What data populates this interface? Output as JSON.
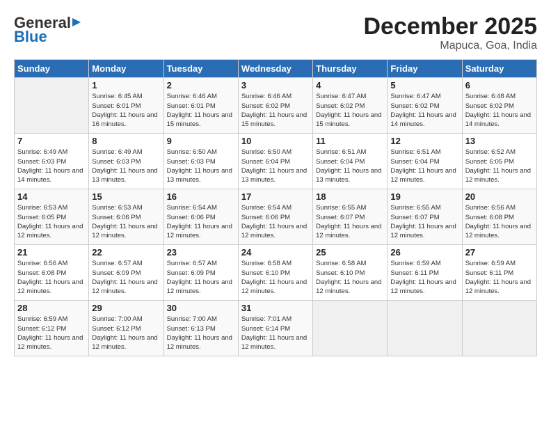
{
  "header": {
    "logo_general": "General",
    "logo_blue": "Blue",
    "month": "December 2025",
    "location": "Mapuca, Goa, India"
  },
  "days_of_week": [
    "Sunday",
    "Monday",
    "Tuesday",
    "Wednesday",
    "Thursday",
    "Friday",
    "Saturday"
  ],
  "weeks": [
    [
      {
        "day": "",
        "sunrise": "",
        "sunset": "",
        "daylight": ""
      },
      {
        "day": "1",
        "sunrise": "Sunrise: 6:45 AM",
        "sunset": "Sunset: 6:01 PM",
        "daylight": "Daylight: 11 hours and 16 minutes."
      },
      {
        "day": "2",
        "sunrise": "Sunrise: 6:46 AM",
        "sunset": "Sunset: 6:01 PM",
        "daylight": "Daylight: 11 hours and 15 minutes."
      },
      {
        "day": "3",
        "sunrise": "Sunrise: 6:46 AM",
        "sunset": "Sunset: 6:02 PM",
        "daylight": "Daylight: 11 hours and 15 minutes."
      },
      {
        "day": "4",
        "sunrise": "Sunrise: 6:47 AM",
        "sunset": "Sunset: 6:02 PM",
        "daylight": "Daylight: 11 hours and 15 minutes."
      },
      {
        "day": "5",
        "sunrise": "Sunrise: 6:47 AM",
        "sunset": "Sunset: 6:02 PM",
        "daylight": "Daylight: 11 hours and 14 minutes."
      },
      {
        "day": "6",
        "sunrise": "Sunrise: 6:48 AM",
        "sunset": "Sunset: 6:02 PM",
        "daylight": "Daylight: 11 hours and 14 minutes."
      }
    ],
    [
      {
        "day": "7",
        "sunrise": "Sunrise: 6:49 AM",
        "sunset": "Sunset: 6:03 PM",
        "daylight": "Daylight: 11 hours and 14 minutes."
      },
      {
        "day": "8",
        "sunrise": "Sunrise: 6:49 AM",
        "sunset": "Sunset: 6:03 PM",
        "daylight": "Daylight: 11 hours and 13 minutes."
      },
      {
        "day": "9",
        "sunrise": "Sunrise: 6:50 AM",
        "sunset": "Sunset: 6:03 PM",
        "daylight": "Daylight: 11 hours and 13 minutes."
      },
      {
        "day": "10",
        "sunrise": "Sunrise: 6:50 AM",
        "sunset": "Sunset: 6:04 PM",
        "daylight": "Daylight: 11 hours and 13 minutes."
      },
      {
        "day": "11",
        "sunrise": "Sunrise: 6:51 AM",
        "sunset": "Sunset: 6:04 PM",
        "daylight": "Daylight: 11 hours and 13 minutes."
      },
      {
        "day": "12",
        "sunrise": "Sunrise: 6:51 AM",
        "sunset": "Sunset: 6:04 PM",
        "daylight": "Daylight: 11 hours and 12 minutes."
      },
      {
        "day": "13",
        "sunrise": "Sunrise: 6:52 AM",
        "sunset": "Sunset: 6:05 PM",
        "daylight": "Daylight: 11 hours and 12 minutes."
      }
    ],
    [
      {
        "day": "14",
        "sunrise": "Sunrise: 6:53 AM",
        "sunset": "Sunset: 6:05 PM",
        "daylight": "Daylight: 11 hours and 12 minutes."
      },
      {
        "day": "15",
        "sunrise": "Sunrise: 6:53 AM",
        "sunset": "Sunset: 6:06 PM",
        "daylight": "Daylight: 11 hours and 12 minutes."
      },
      {
        "day": "16",
        "sunrise": "Sunrise: 6:54 AM",
        "sunset": "Sunset: 6:06 PM",
        "daylight": "Daylight: 11 hours and 12 minutes."
      },
      {
        "day": "17",
        "sunrise": "Sunrise: 6:54 AM",
        "sunset": "Sunset: 6:06 PM",
        "daylight": "Daylight: 11 hours and 12 minutes."
      },
      {
        "day": "18",
        "sunrise": "Sunrise: 6:55 AM",
        "sunset": "Sunset: 6:07 PM",
        "daylight": "Daylight: 11 hours and 12 minutes."
      },
      {
        "day": "19",
        "sunrise": "Sunrise: 6:55 AM",
        "sunset": "Sunset: 6:07 PM",
        "daylight": "Daylight: 11 hours and 12 minutes."
      },
      {
        "day": "20",
        "sunrise": "Sunrise: 6:56 AM",
        "sunset": "Sunset: 6:08 PM",
        "daylight": "Daylight: 11 hours and 12 minutes."
      }
    ],
    [
      {
        "day": "21",
        "sunrise": "Sunrise: 6:56 AM",
        "sunset": "Sunset: 6:08 PM",
        "daylight": "Daylight: 11 hours and 12 minutes."
      },
      {
        "day": "22",
        "sunrise": "Sunrise: 6:57 AM",
        "sunset": "Sunset: 6:09 PM",
        "daylight": "Daylight: 11 hours and 12 minutes."
      },
      {
        "day": "23",
        "sunrise": "Sunrise: 6:57 AM",
        "sunset": "Sunset: 6:09 PM",
        "daylight": "Daylight: 11 hours and 12 minutes."
      },
      {
        "day": "24",
        "sunrise": "Sunrise: 6:58 AM",
        "sunset": "Sunset: 6:10 PM",
        "daylight": "Daylight: 11 hours and 12 minutes."
      },
      {
        "day": "25",
        "sunrise": "Sunrise: 6:58 AM",
        "sunset": "Sunset: 6:10 PM",
        "daylight": "Daylight: 11 hours and 12 minutes."
      },
      {
        "day": "26",
        "sunrise": "Sunrise: 6:59 AM",
        "sunset": "Sunset: 6:11 PM",
        "daylight": "Daylight: 11 hours and 12 minutes."
      },
      {
        "day": "27",
        "sunrise": "Sunrise: 6:59 AM",
        "sunset": "Sunset: 6:11 PM",
        "daylight": "Daylight: 11 hours and 12 minutes."
      }
    ],
    [
      {
        "day": "28",
        "sunrise": "Sunrise: 6:59 AM",
        "sunset": "Sunset: 6:12 PM",
        "daylight": "Daylight: 11 hours and 12 minutes."
      },
      {
        "day": "29",
        "sunrise": "Sunrise: 7:00 AM",
        "sunset": "Sunset: 6:12 PM",
        "daylight": "Daylight: 11 hours and 12 minutes."
      },
      {
        "day": "30",
        "sunrise": "Sunrise: 7:00 AM",
        "sunset": "Sunset: 6:13 PM",
        "daylight": "Daylight: 11 hours and 12 minutes."
      },
      {
        "day": "31",
        "sunrise": "Sunrise: 7:01 AM",
        "sunset": "Sunset: 6:14 PM",
        "daylight": "Daylight: 11 hours and 12 minutes."
      },
      {
        "day": "",
        "sunrise": "",
        "sunset": "",
        "daylight": ""
      },
      {
        "day": "",
        "sunrise": "",
        "sunset": "",
        "daylight": ""
      },
      {
        "day": "",
        "sunrise": "",
        "sunset": "",
        "daylight": ""
      }
    ]
  ]
}
